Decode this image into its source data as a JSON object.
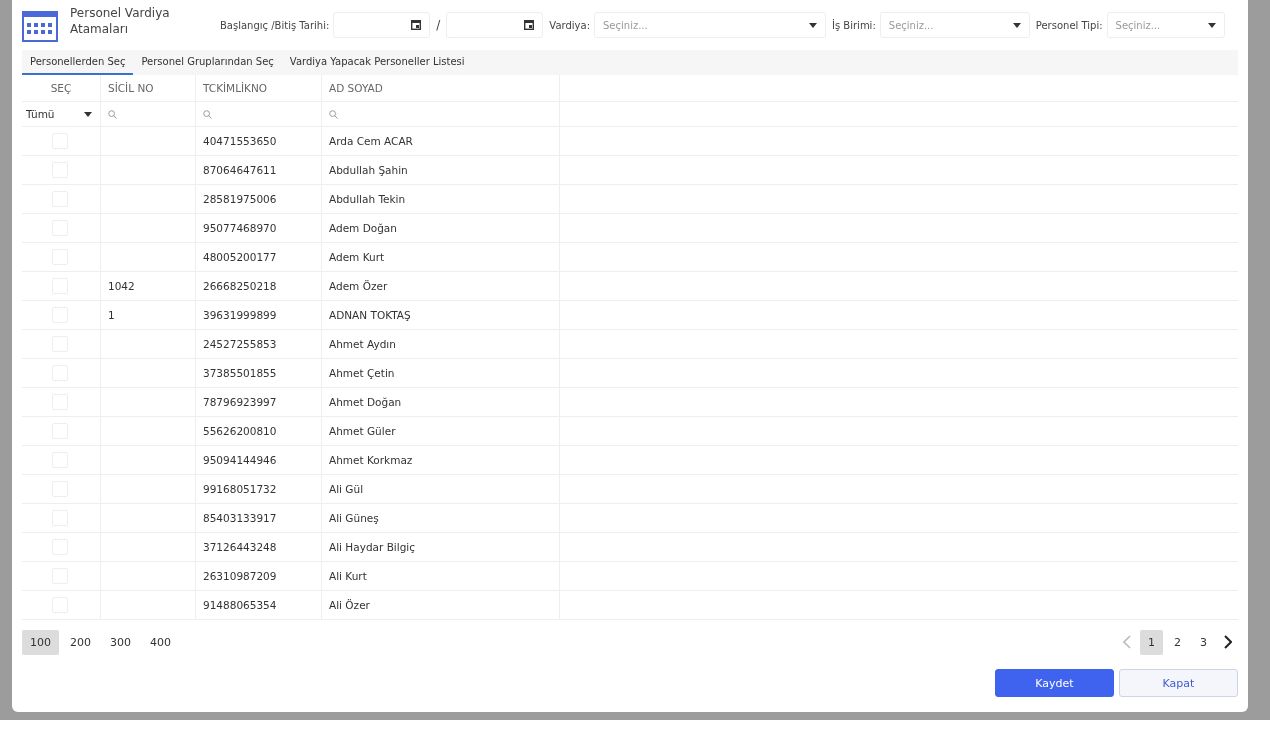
{
  "dialog": {
    "title_lines": [
      "Personel Vardiya",
      "Atamaları"
    ]
  },
  "filters": [
    {
      "kind": "date-range",
      "label": "Başlangıç /Bitiş Tarihi:",
      "separator": "/"
    },
    {
      "kind": "select",
      "label": "Vardiya:",
      "placeholder": "Seçiniz..."
    },
    {
      "kind": "select",
      "label": "İş Birimi:",
      "placeholder": "Seçiniz..."
    },
    {
      "kind": "select",
      "label": "Personel Tipi:",
      "placeholder": "Seçiniz..."
    }
  ],
  "tabs": [
    {
      "label": "Personellerden Seç",
      "selected": true
    },
    {
      "label": "Personel Gruplarından Seç",
      "selected": false
    },
    {
      "label": "Vardiya Yapacak Personeller Listesi",
      "selected": false
    }
  ],
  "table": {
    "columns": [
      "SEÇ",
      "SİCİL NO",
      "TCKİMLİKNO",
      "AD SOYAD"
    ],
    "select_filter": "Tümü",
    "rows": [
      {
        "checked": false,
        "sicil": "",
        "tc": "40471553650",
        "name": "Arda Cem ACAR"
      },
      {
        "checked": false,
        "sicil": "",
        "tc": "87064647611",
        "name": "Abdullah Şahin"
      },
      {
        "checked": false,
        "sicil": "",
        "tc": "28581975006",
        "name": "Abdullah Tekin"
      },
      {
        "checked": false,
        "sicil": "",
        "tc": "95077468970",
        "name": "Adem Doğan"
      },
      {
        "checked": false,
        "sicil": "",
        "tc": "48005200177",
        "name": "Adem Kurt"
      },
      {
        "checked": false,
        "sicil": "1042",
        "tc": "26668250218",
        "name": "Adem Özer"
      },
      {
        "checked": false,
        "sicil": "1",
        "tc": "39631999899",
        "name": "ADNAN TOKTAŞ"
      },
      {
        "checked": false,
        "sicil": "",
        "tc": "24527255853",
        "name": "Ahmet Aydın"
      },
      {
        "checked": false,
        "sicil": "",
        "tc": "37385501855",
        "name": "Ahmet Çetin"
      },
      {
        "checked": false,
        "sicil": "",
        "tc": "78796923997",
        "name": "Ahmet Doğan"
      },
      {
        "checked": false,
        "sicil": "",
        "tc": "55626200810",
        "name": "Ahmet Güler"
      },
      {
        "checked": false,
        "sicil": "",
        "tc": "95094144946",
        "name": "Ahmet Korkmaz"
      },
      {
        "checked": false,
        "sicil": "",
        "tc": "99168051732",
        "name": "Ali Gül"
      },
      {
        "checked": false,
        "sicil": "",
        "tc": "85403133917",
        "name": "Ali Güneş"
      },
      {
        "checked": false,
        "sicil": "",
        "tc": "37126443248",
        "name": "Ali Haydar Bilgiç"
      },
      {
        "checked": false,
        "sicil": "",
        "tc": "26310987209",
        "name": "Ali Kurt"
      },
      {
        "checked": false,
        "sicil": "",
        "tc": "91488065354",
        "name": "Ali Özer"
      }
    ]
  },
  "page_sizes": [
    {
      "label": "100",
      "selected": true
    },
    {
      "label": "200",
      "selected": false
    },
    {
      "label": "300",
      "selected": false
    },
    {
      "label": "400",
      "selected": false
    }
  ],
  "pager": {
    "prev_disabled": true,
    "next_disabled": false,
    "pages": [
      {
        "label": "1",
        "selected": true
      },
      {
        "label": "2",
        "selected": false
      },
      {
        "label": "3",
        "selected": false
      }
    ]
  },
  "buttons": [
    {
      "kind": "primary",
      "label": "Kaydet"
    },
    {
      "kind": "secondary",
      "label": "Kapat"
    }
  ]
}
